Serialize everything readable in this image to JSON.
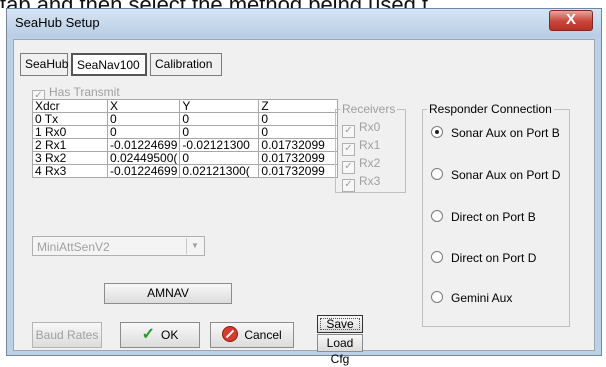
{
  "top_text": "tab and then select the method being used t",
  "window": {
    "title": "SeaHub Setup",
    "close_glyph": "X"
  },
  "tabs": [
    {
      "label": "SeaHub",
      "active": false
    },
    {
      "label": "SeaNav100",
      "active": true
    },
    {
      "label": "Calibration",
      "active": false
    }
  ],
  "has_transmit": {
    "label": "Has Transmit",
    "checked": true,
    "enabled": false
  },
  "table": {
    "headers": [
      "Xdcr",
      "X",
      "Y",
      "Z"
    ],
    "rows": [
      [
        "0 Tx",
        "0",
        "0",
        "0"
      ],
      [
        "1 Rx0",
        "0",
        "0",
        "0"
      ],
      [
        "2 Rx1",
        "-0.01224699",
        "-0.02121300",
        "0.01732099"
      ],
      [
        "3 Rx2",
        "0.02449500(",
        "0",
        "0.01732099"
      ],
      [
        "4 Rx3",
        "-0.01224699",
        "0.02121300(",
        "0.01732099"
      ]
    ]
  },
  "receivers": {
    "title": "Receivers",
    "items": [
      "Rx0",
      "Rx1",
      "Rx2",
      "Rx3"
    ]
  },
  "responder": {
    "title": "Responder Connection",
    "options": [
      {
        "label": "Sonar Aux on Port B",
        "selected": true
      },
      {
        "label": "Sonar Aux on Port D",
        "selected": false
      },
      {
        "label": "Direct on Port B",
        "selected": false
      },
      {
        "label": "Direct on Port D",
        "selected": false
      },
      {
        "label": "Gemini Aux",
        "selected": false
      }
    ]
  },
  "sensor_select": {
    "value": "MiniAttSenV2"
  },
  "buttons": {
    "amnav": "AMNAV",
    "save_cfg": "Save Cfg",
    "load_cfg": "Load Cfg",
    "baud_rates": "Baud Rates",
    "ok": "OK",
    "cancel": "Cancel"
  },
  "colors": {
    "ok_check": "#2a9b2a",
    "cancel_icon": "#d73a2e",
    "close_button": "#c7463a"
  }
}
